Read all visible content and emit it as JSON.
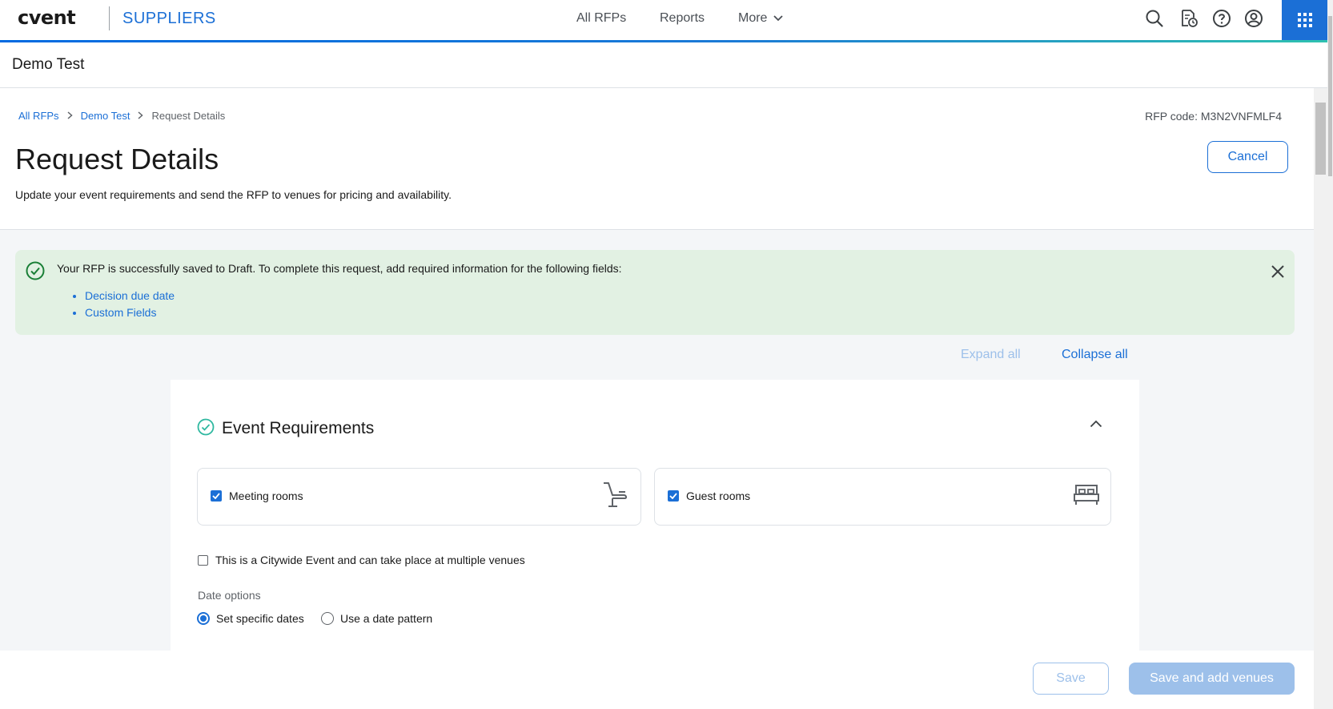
{
  "nav": {
    "logo": "cvent",
    "product": "SUPPLIERS",
    "links": [
      "All RFPs",
      "Reports",
      "More"
    ]
  },
  "subheader": {
    "title": "Demo Test"
  },
  "page": {
    "breadcrumb": [
      "All RFPs",
      "Demo Test",
      "Request Details"
    ],
    "rfp_code": "RFP code: M3N2VNFMLF4",
    "title": "Request Details",
    "subtitle": "Update your event requirements and send the RFP to venues for pricing and availability.",
    "cancel_label": "Cancel"
  },
  "alert": {
    "message": "Your RFP is successfully saved to Draft. To complete this request, add required information for the following fields:",
    "fields": [
      "Decision due date",
      "Custom Fields"
    ]
  },
  "controls": {
    "expand_all": "Expand all",
    "collapse_all": "Collapse all"
  },
  "section": {
    "title": "Event Requirements",
    "options": [
      {
        "label": "Meeting rooms",
        "checked": true,
        "icon": "chair-icon"
      },
      {
        "label": "Guest rooms",
        "checked": true,
        "icon": "bed-icon"
      }
    ],
    "citywide_label": "This is a Citywide Event and can take place at multiple venues",
    "date_options_label": "Date options",
    "date_options": [
      {
        "label": "Set specific dates",
        "selected": true
      },
      {
        "label": "Use a date pattern",
        "selected": false
      }
    ]
  },
  "footer": {
    "save_label": "Save",
    "save_add_label": "Save and add venues"
  },
  "colors": {
    "brand": "#1b6fd6",
    "success_bg": "#e2f1e3",
    "success": "#1a7f37",
    "teal": "#2fb8a0"
  }
}
